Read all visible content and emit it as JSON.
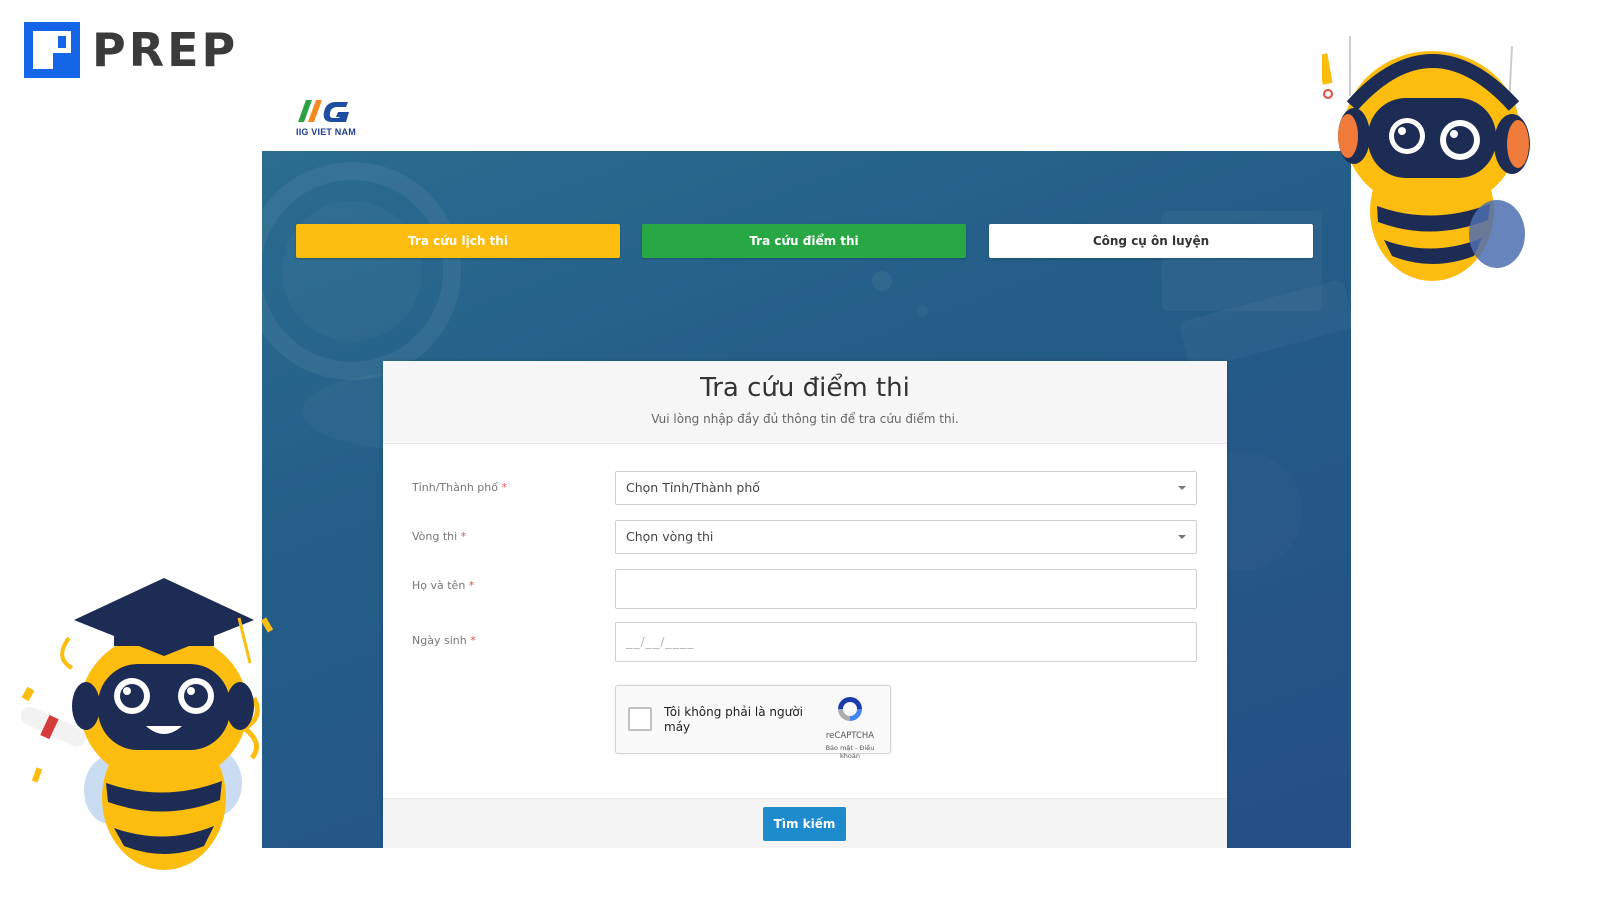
{
  "brand": {
    "name": "PREP"
  },
  "partner": {
    "name": "IIG VIET NAM"
  },
  "nav": {
    "lich_thi": "Tra cứu lịch thi",
    "diem_thi": "Tra cứu điểm thi",
    "cong_cu": "Công cụ ôn luyện"
  },
  "form": {
    "title": "Tra cứu điểm thi",
    "subtitle": "Vui lòng nhập đầy đủ thông tin để tra cứu điểm thi.",
    "fields": {
      "province": {
        "label": "Tỉnh/Thành phố",
        "value": "Chọn Tỉnh/Thành phố"
      },
      "round": {
        "label": "Vòng thi",
        "value": "Chọn vòng thi"
      },
      "fullname": {
        "label": "Họ và tên",
        "value": ""
      },
      "dob": {
        "label": "Ngày sinh",
        "placeholder": "__/__/____"
      }
    },
    "required_mark": "*",
    "captcha": {
      "text": "Tôi không phải là người máy",
      "brand": "reCAPTCHA",
      "terms": "Bảo mật - Điều khoản"
    },
    "submit": "Tìm kiếm"
  },
  "colors": {
    "accent_yellow": "#fcbd0f",
    "accent_green": "#27a844",
    "panel_blue": "#245d88",
    "submit_blue": "#1e8bcd",
    "prep_blue": "#1565e8"
  }
}
